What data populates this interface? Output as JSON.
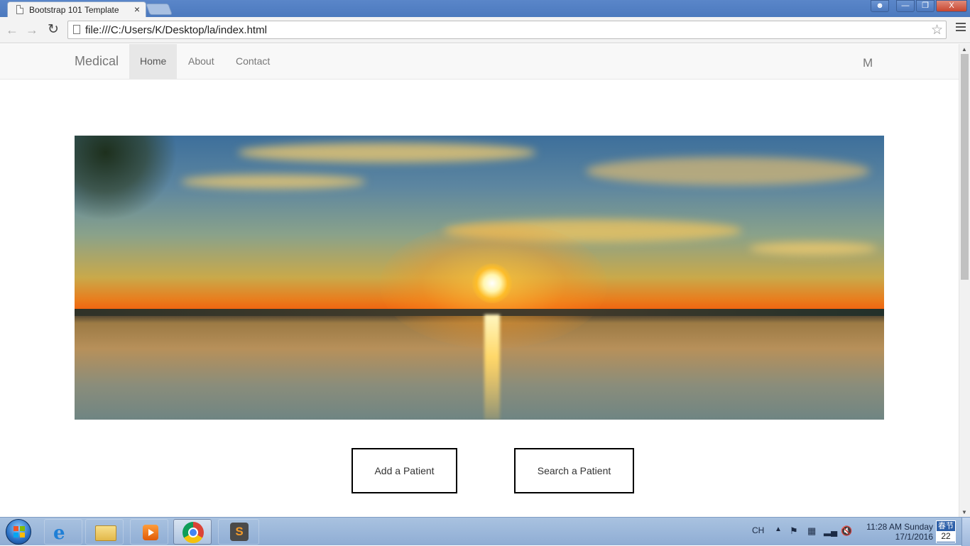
{
  "browser": {
    "tab_title": "Bootstrap 101 Template",
    "tab_close": "×",
    "address": "file:///C:/Users/K/Desktop/la/index.html",
    "back_icon": "arrow-left-icon",
    "forward_icon": "arrow-right-icon",
    "reload_icon": "reload-icon",
    "star_icon": "star-icon",
    "menu_icon": "hamburger-menu-icon",
    "window_buttons": [
      "user",
      "minimize",
      "restore",
      "close"
    ]
  },
  "site": {
    "brand": "Medical",
    "nav": {
      "home": "Home",
      "about": "About",
      "contact": "Contact"
    },
    "nav_right": "M",
    "buttons": {
      "add_patient": "Add a Patient",
      "search_patient": "Search a Patient"
    }
  },
  "taskbar": {
    "apps": [
      "Internet Explorer",
      "Windows Explorer",
      "Windows Media Player",
      "Google Chrome",
      "Sublime Text"
    ],
    "active_app": "Google Chrome",
    "language": "CH",
    "clock_time": "11:28 AM Sunday",
    "clock_date": "17/1/2016",
    "calendar_label": "春节",
    "calendar_day": "22"
  }
}
